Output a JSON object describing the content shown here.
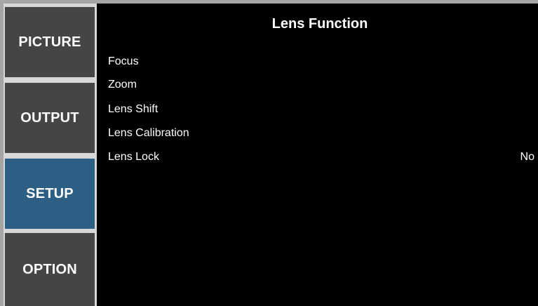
{
  "tabs": [
    {
      "label": "PICTURE",
      "active": false
    },
    {
      "label": "OUTPUT",
      "active": false
    },
    {
      "label": "SETUP",
      "active": true
    },
    {
      "label": "OPTION",
      "active": false
    }
  ],
  "menu": {
    "title": "Lens Function",
    "items": [
      {
        "label": "Focus",
        "value": ""
      },
      {
        "label": "Zoom",
        "value": ""
      },
      {
        "label": "Lens Shift",
        "value": ""
      },
      {
        "label": "Lens Calibration",
        "value": ""
      },
      {
        "label": "Lens Lock",
        "value": "No"
      }
    ]
  },
  "colors": {
    "frame": "#a6a6a6",
    "background": "#000000",
    "tab": "#454545",
    "tab_active": "#2d5f84",
    "text": "#ffffff"
  }
}
